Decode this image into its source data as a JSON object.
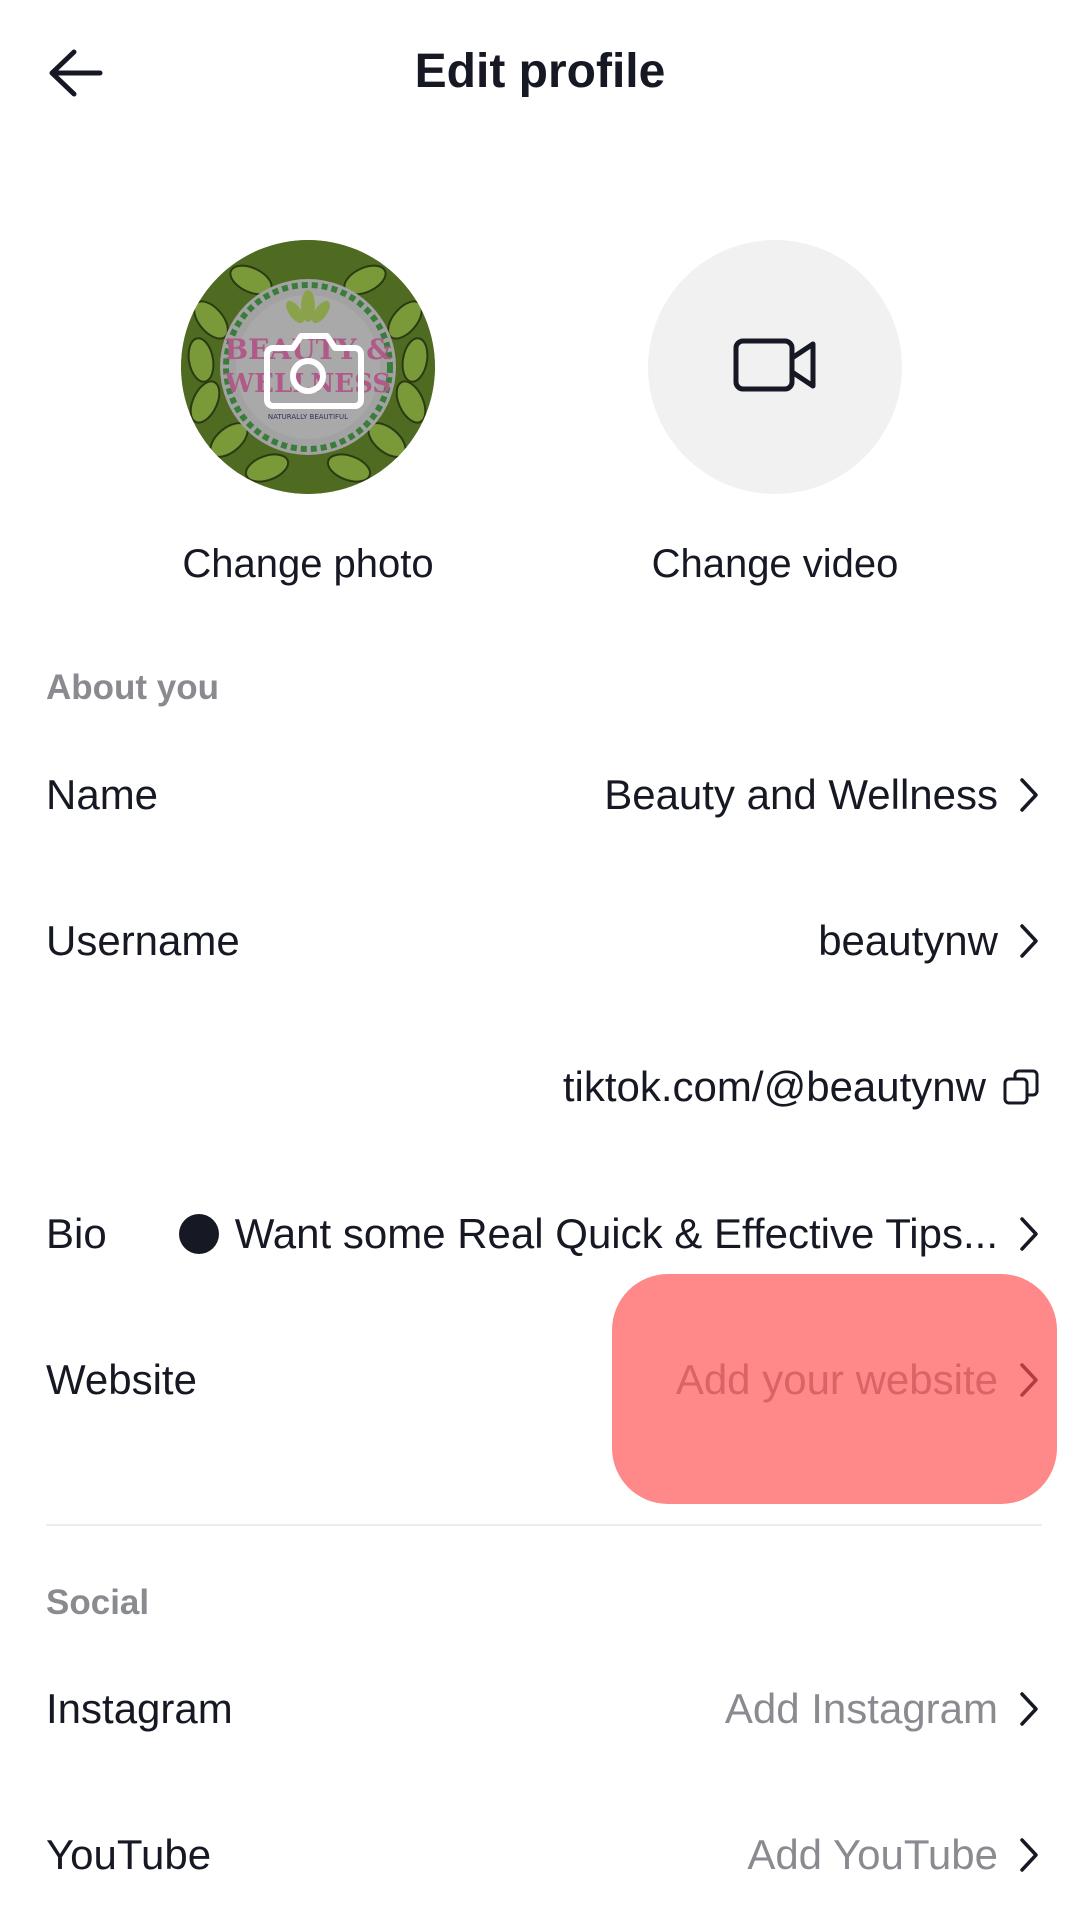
{
  "header": {
    "title": "Edit profile",
    "back_icon": "arrow-left-icon"
  },
  "media": {
    "photo_label": "Change photo",
    "video_label": "Change video",
    "photo_icon": "camera-icon",
    "video_icon": "video-camera-icon",
    "logo_lines": [
      "BEAUTY &",
      "WELLNESS",
      "NATURALLY BEAUTIFUL"
    ]
  },
  "about": {
    "section_label": "About you",
    "name": {
      "label": "Name",
      "value": "Beauty and Wellness"
    },
    "username": {
      "label": "Username",
      "value": "beautynw"
    },
    "link": {
      "value": "tiktok.com/@beautynw",
      "icon": "copy-icon"
    },
    "bio": {
      "label": "Bio",
      "value": "Want some Real Quick & Effective Tips..."
    },
    "website": {
      "label": "Website",
      "value": "Add your website"
    }
  },
  "social": {
    "section_label": "Social",
    "instagram": {
      "label": "Instagram",
      "value": "Add Instagram"
    },
    "youtube": {
      "label": "YouTube",
      "value": "Add YouTube"
    }
  },
  "colors": {
    "text_primary": "#161823",
    "text_secondary": "#8a8b91",
    "highlight": "#ff5050"
  }
}
